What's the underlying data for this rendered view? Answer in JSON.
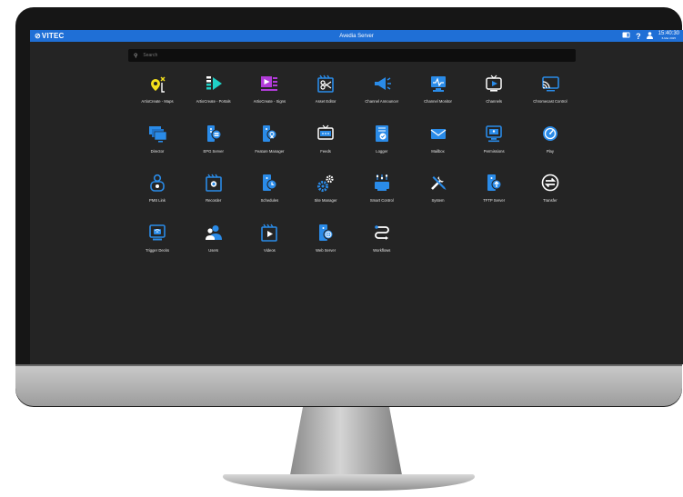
{
  "header": {
    "brand": "VITEC",
    "title": "Avedia Server",
    "time": "15:40:30",
    "date": "6-Mar 2025"
  },
  "search": {
    "placeholder": "Search"
  },
  "colors": {
    "accent": "#1f6fd6",
    "icon_blue": "#2a8be8",
    "warn_yellow": "#f4e01c",
    "magenta": "#b13bd8",
    "teal": "#1fd0c6"
  },
  "apps": [
    {
      "label": "ArtioCreate - Maps",
      "icon": "map-pin-icon"
    },
    {
      "label": "ArtioCreate - Portals",
      "icon": "portal-play-icon"
    },
    {
      "label": "ArtioCreate - Signs",
      "icon": "sign-play-icon"
    },
    {
      "label": "Asset Editor",
      "icon": "scissors-film-icon"
    },
    {
      "label": "Channel Announcer",
      "icon": "megaphone-icon"
    },
    {
      "label": "Channel Monitor",
      "icon": "monitor-waveform-icon"
    },
    {
      "label": "Channels",
      "icon": "tv-play-icon"
    },
    {
      "label": "Chromecast Control",
      "icon": "cast-icon"
    },
    {
      "label": "Director",
      "icon": "stacked-screens-icon"
    },
    {
      "label": "EPG Server",
      "icon": "epg-server-icon"
    },
    {
      "label": "Feature Manager",
      "icon": "feature-server-icon"
    },
    {
      "label": "Feeds",
      "icon": "tv-feed-icon"
    },
    {
      "label": "Logger",
      "icon": "log-check-icon"
    },
    {
      "label": "Mailbox",
      "icon": "envelope-icon"
    },
    {
      "label": "Permissions",
      "icon": "permissions-screen-icon"
    },
    {
      "label": "Play",
      "icon": "play-gauge-icon"
    },
    {
      "label": "PMS Link",
      "icon": "pms-link-icon"
    },
    {
      "label": "Recorder",
      "icon": "recorder-film-icon"
    },
    {
      "label": "Schedules",
      "icon": "schedule-clock-icon"
    },
    {
      "label": "Site Manager",
      "icon": "gears-icon"
    },
    {
      "label": "Smart Control",
      "icon": "sliders-icon"
    },
    {
      "label": "System",
      "icon": "tools-icon"
    },
    {
      "label": "TFTP Server",
      "icon": "tftp-upload-icon"
    },
    {
      "label": "Transfer",
      "icon": "transfer-arrows-icon"
    },
    {
      "label": "Trigger Decks",
      "icon": "trigger-deck-icon"
    },
    {
      "label": "Users",
      "icon": "users-icon"
    },
    {
      "label": "Videos",
      "icon": "video-film-icon"
    },
    {
      "label": "Web Server",
      "icon": "web-globe-icon"
    },
    {
      "label": "Workflows",
      "icon": "workflow-icon"
    }
  ]
}
